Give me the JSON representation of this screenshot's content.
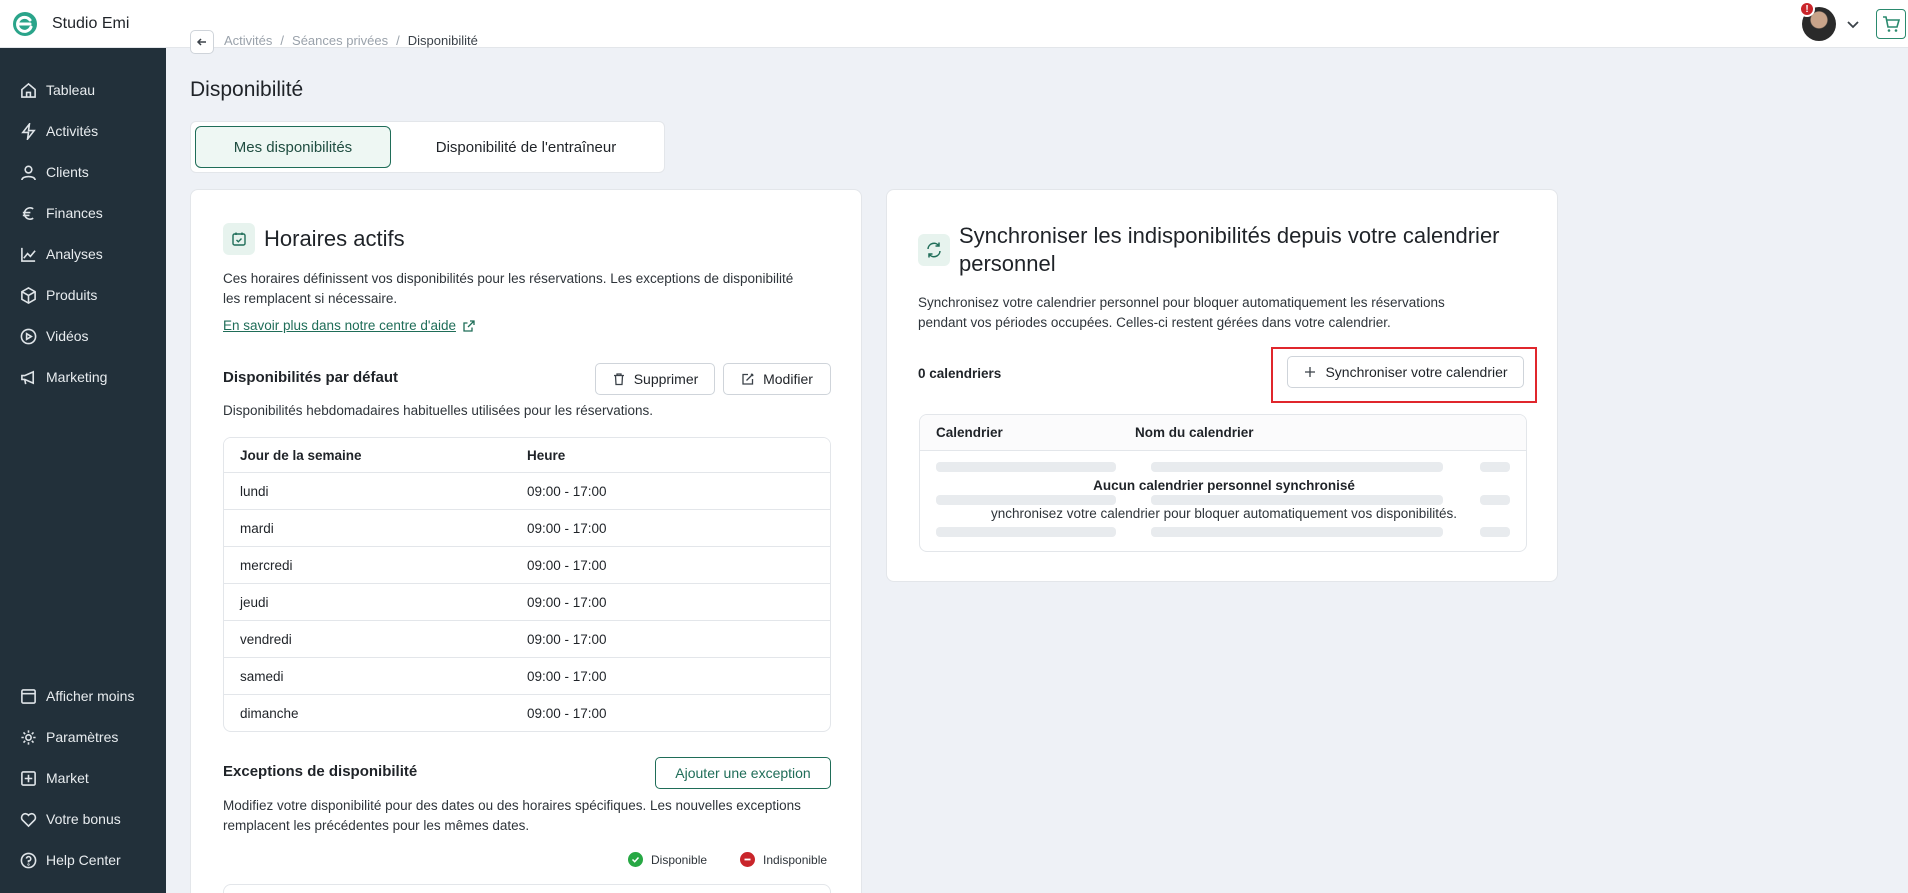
{
  "app": {
    "title": "Studio Emi",
    "notification_count": "!"
  },
  "sidebar": {
    "items": [
      {
        "label": "Tableau",
        "icon": "home-icon"
      },
      {
        "label": "Activités",
        "icon": "lightning-icon"
      },
      {
        "label": "Clients",
        "icon": "user-icon"
      },
      {
        "label": "Finances",
        "icon": "euro-icon"
      },
      {
        "label": "Analyses",
        "icon": "chart-line-icon"
      },
      {
        "label": "Produits",
        "icon": "box-icon"
      },
      {
        "label": "Vidéos",
        "icon": "play-icon"
      },
      {
        "label": "Marketing",
        "icon": "megaphone-icon"
      }
    ],
    "bottom_items": [
      {
        "label": "Afficher moins",
        "icon": "collapse-icon"
      },
      {
        "label": "Paramètres",
        "icon": "gear-icon"
      },
      {
        "label": "Market",
        "icon": "plus-square-icon"
      },
      {
        "label": "Votre bonus",
        "icon": "heart-icon"
      },
      {
        "label": "Help Center",
        "icon": "help-icon"
      }
    ]
  },
  "breadcrumb": {
    "items": [
      "Activités",
      "Séances privées"
    ],
    "current": "Disponibilité",
    "separator": "/"
  },
  "page_title": "Disponibilité",
  "tabs": {
    "active": "Mes disponibilités",
    "inactive": "Disponibilité de l'entraîneur"
  },
  "left": {
    "title": "Horaires actifs",
    "desc": [
      "Ces horaires définissent vos disponibilités pour les réservations. Les exceptions de disponibilité",
      "les remplacent si nécessaire."
    ],
    "help_link": "En savoir plus dans notre centre d'aide",
    "default_title": "Disponibilités par défaut",
    "delete_label": "Supprimer",
    "edit_label": "Modifier",
    "default_desc": "Disponibilités hebdomadaires habituelles utilisées pour les réservations.",
    "table": {
      "headers": [
        "Jour de la semaine",
        "Heure"
      ],
      "rows": [
        {
          "day": "lundi",
          "time": "09:00 - 17:00"
        },
        {
          "day": "mardi",
          "time": "09:00 - 17:00"
        },
        {
          "day": "mercredi",
          "time": "09:00 - 17:00"
        },
        {
          "day": "jeudi",
          "time": "09:00 - 17:00"
        },
        {
          "day": "vendredi",
          "time": "09:00 - 17:00"
        },
        {
          "day": "samedi",
          "time": "09:00 - 17:00"
        },
        {
          "day": "dimanche",
          "time": "09:00 - 17:00"
        }
      ]
    },
    "exceptions_title": "Exceptions de disponibilité",
    "add_exception_label": "Ajouter une exception",
    "exceptions_desc": [
      "Modifiez votre disponibilité pour des dates ou des horaires spécifiques. Les nouvelles exceptions",
      "remplacent les précédentes pour les mêmes dates."
    ],
    "legend_available": "Disponible",
    "legend_unavailable": "Indisponible"
  },
  "right": {
    "title_line1": "Synchroniser les indisponibilités depuis votre calendrier",
    "title_line2": "personnel",
    "desc": [
      "Synchronisez votre calendrier personnel pour bloquer automatiquement les réservations",
      "pendant vos périodes occupées. Celles-ci restent gérées dans votre calendrier."
    ],
    "count_label": "0 calendriers",
    "sync_button": "Synchroniser votre calendrier",
    "table_headers": [
      "Calendrier",
      "Nom du calendrier"
    ],
    "empty_title": "Aucun calendrier personnel synchronisé",
    "empty_sub": "ynchronisez votre calendrier pour bloquer automatiquement vos disponibilités."
  },
  "colors": {
    "sidebar": "#22303a",
    "accent": "#1f6d58",
    "highlight": "#e0262c",
    "available": "#27a844",
    "unavailable": "#c9252b"
  }
}
